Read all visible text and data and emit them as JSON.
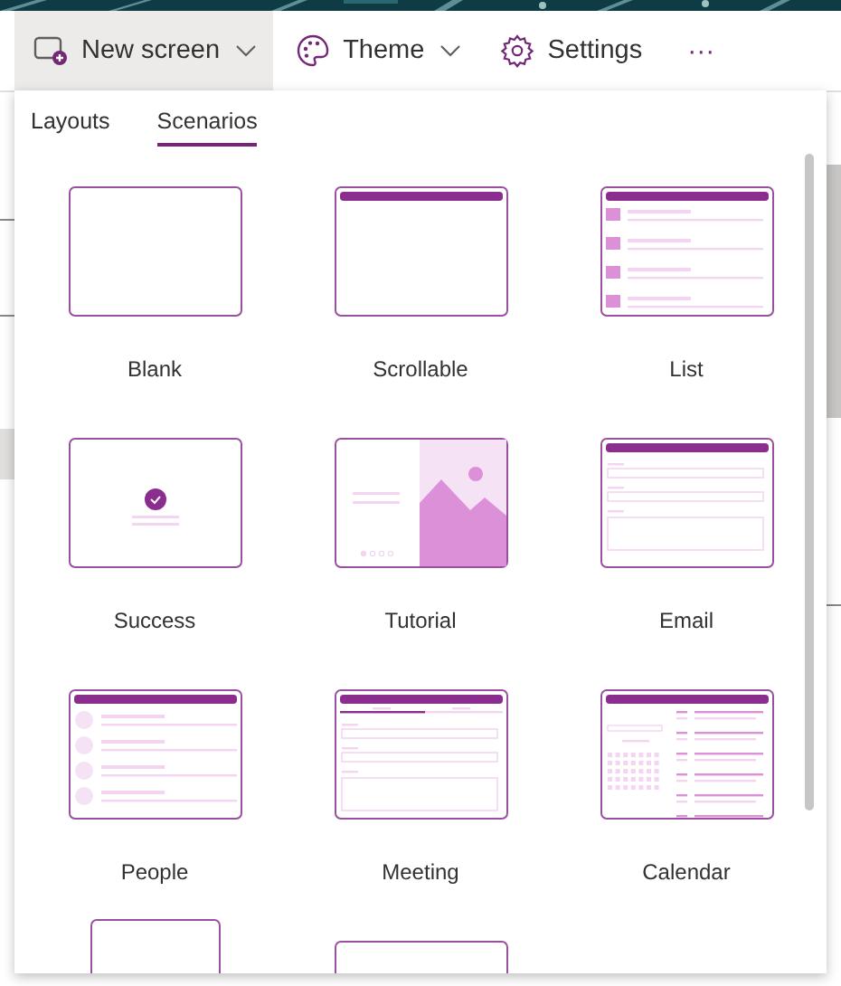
{
  "toolbar": {
    "items": [
      {
        "kind": "new-screen",
        "label": "New screen",
        "chevron": true,
        "expanded": true
      },
      {
        "kind": "theme",
        "label": "Theme",
        "chevron": true,
        "expanded": false
      },
      {
        "kind": "settings",
        "label": "Settings",
        "chevron": false,
        "expanded": false
      },
      {
        "kind": "more",
        "label": "···",
        "chevron": false,
        "expanded": false
      }
    ]
  },
  "panel": {
    "tabs": [
      {
        "label": "Layouts",
        "selected": false
      },
      {
        "label": "Scenarios",
        "selected": true
      }
    ],
    "tiles": [
      {
        "kind": "blank",
        "label": "Blank"
      },
      {
        "kind": "scrollable",
        "label": "Scrollable"
      },
      {
        "kind": "list",
        "label": "List"
      },
      {
        "kind": "success",
        "label": "Success"
      },
      {
        "kind": "tutorial",
        "label": "Tutorial"
      },
      {
        "kind": "email",
        "label": "Email"
      },
      {
        "kind": "people",
        "label": "People"
      },
      {
        "kind": "meeting",
        "label": "Meeting"
      },
      {
        "kind": "calendar",
        "label": "Calendar"
      },
      {
        "kind": "portrait"
      },
      {
        "kind": "blank"
      }
    ]
  }
}
